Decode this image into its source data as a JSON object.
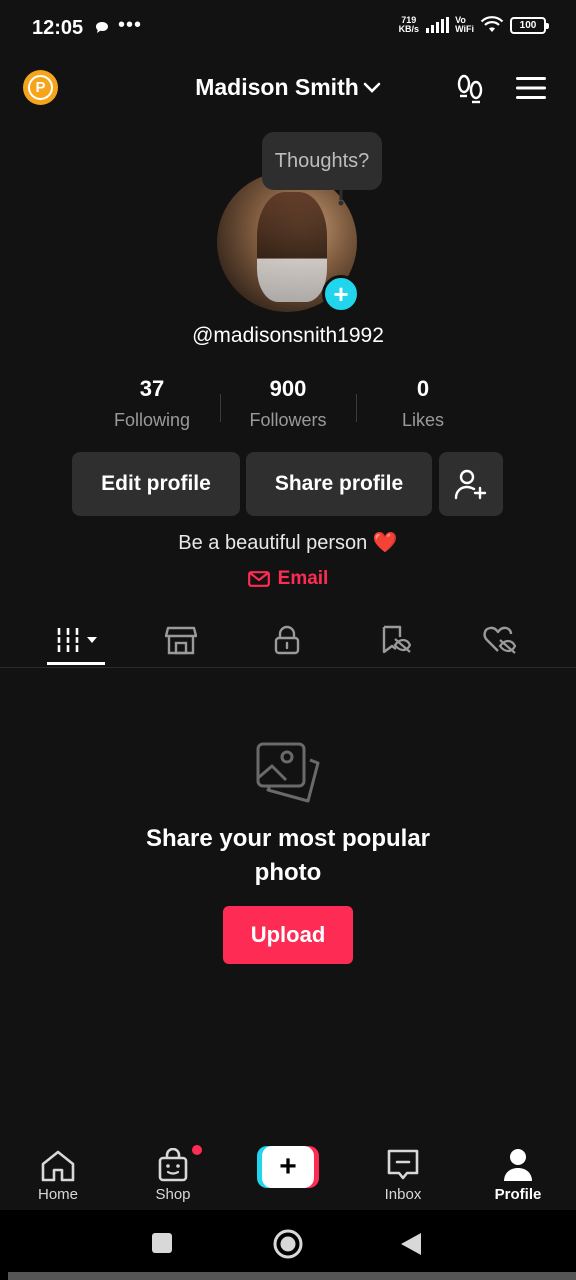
{
  "status_bar": {
    "time": "12:05",
    "net_speed_value": "719",
    "net_speed_unit": "KB/s",
    "vo": "Vo",
    "wifi": "WiFi",
    "battery": "100"
  },
  "header": {
    "badge_letter": "P",
    "profile_name": "Madison Smith"
  },
  "profile": {
    "thoughts_placeholder": "Thoughts?",
    "username": "@madisonsnith1992",
    "bio": "Be a beautiful person ❤️",
    "email_label": "Email"
  },
  "stats": [
    {
      "value": "37",
      "label": "Following"
    },
    {
      "value": "900",
      "label": "Followers"
    },
    {
      "value": "0",
      "label": "Likes"
    }
  ],
  "actions": {
    "edit_profile": "Edit profile",
    "share_profile": "Share profile"
  },
  "empty_state": {
    "title_line1": "Share your most popular",
    "title_line2": "photo",
    "upload_label": "Upload"
  },
  "bottom_nav": [
    {
      "label": "Home",
      "icon": "home-icon"
    },
    {
      "label": "Shop",
      "icon": "shop-bag-icon"
    },
    {
      "label": "",
      "icon": "create-plus-icon"
    },
    {
      "label": "Inbox",
      "icon": "inbox-icon"
    },
    {
      "label": "Profile",
      "icon": "person-icon",
      "active": true
    }
  ],
  "colors": {
    "accent": "#fe2c55",
    "cyan": "#20d5ec",
    "badge": "#f6a51b",
    "background": "#121212"
  }
}
